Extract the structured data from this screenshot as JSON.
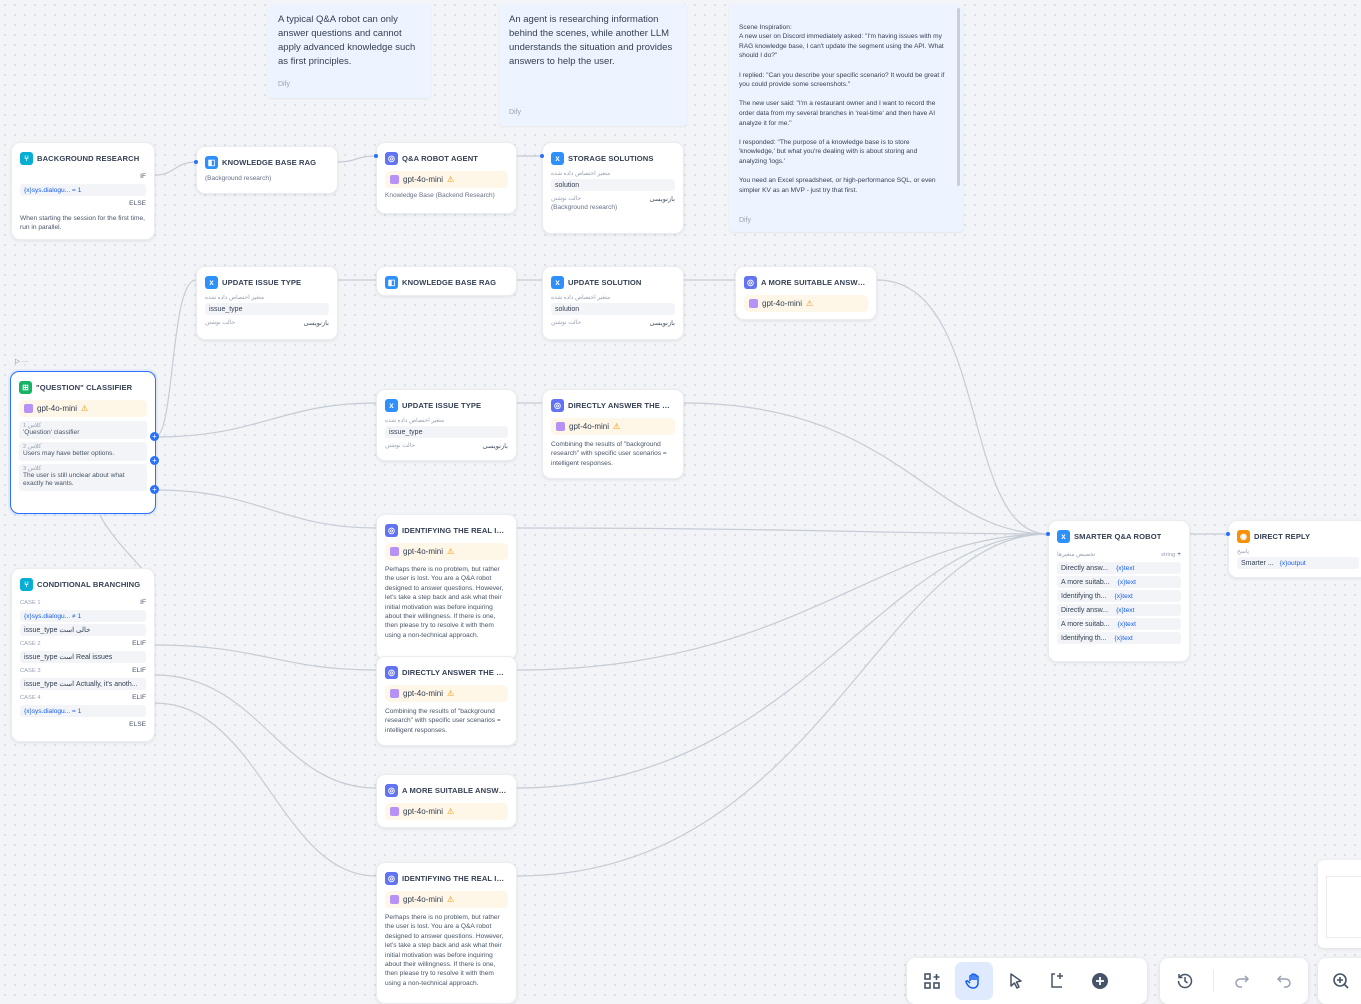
{
  "notes": [
    {
      "text": "A typical Q&A robot can only answer questions and cannot apply advanced knowledge such as first principles.",
      "author": "Dify"
    },
    {
      "text": "An agent is researching information behind the scenes, while another LLM understands the situation and provides answers to help the user.",
      "author": "Dify"
    },
    {
      "text": "Scene Inspiration:\nA new user on Discord immediately asked: \"I'm having issues with my RAG knowledge base, I can't update the segment using the API. What should I do?\"\n\nI replied: \"Can you describe your specific scenario? It would be great if you could provide some screenshots.\"\n\nThe new user said: \"I'm a restaurant owner and I want to record the order data from my several branches in 'real-time' and then have AI analyze it for me.\"\n\nI responded: \"The purpose of a knowledge base is to store 'knowledge,' but what you're dealing with is about storing and analyzing 'logs.'\n\nYou need an Excel spreadsheet, or high-performance SQL, or even simpler KV as an MVP - just try that first.",
      "author": "Dify"
    }
  ],
  "nodes": {
    "background_research": {
      "title": "BACKGROUND RESEARCH",
      "if_label": "IF",
      "condition": "{x}sys.dialogu... = 1",
      "else_label": "ELSE",
      "desc": "When starting the session for the first time, run in parallel."
    },
    "kb_rag_1": {
      "title": "KNOWLEDGE BASE RAG",
      "sub": "(Background research)"
    },
    "qa_robot_agent": {
      "title": "Q&A ROBOT AGENT",
      "model": "gpt-4o-mini",
      "sub": "Knowledge Base (Backend Research)"
    },
    "storage_solutions": {
      "title": "STORAGE SOLUTIONS",
      "assign_label": "متغیر اختصاص داده شده",
      "var": "solution",
      "mode_label": "حالت نوشتن",
      "mode": "بازنویسی",
      "sub": "(Background research)"
    },
    "update_issue_type_1": {
      "title": "UPDATE ISSUE TYPE",
      "assign_label": "متغیر اختصاص داده شده",
      "var": "issue_type",
      "mode_label": "حالت نوشتن",
      "mode": "بازنویسی"
    },
    "kb_rag_2": {
      "title": "KNOWLEDGE BASE RAG"
    },
    "update_solution": {
      "title": "UPDATE SOLUTION",
      "assign_label": "متغیر اختصاص داده شده",
      "var": "solution",
      "mode_label": "حالت نوشتن",
      "mode": "بازنویسی"
    },
    "more_suitable_1": {
      "title": "A MORE SUITABLE ANSWER",
      "model": "gpt-4o-mini"
    },
    "question_classifier": {
      "title": "\"QUESTION\" CLASSIFIER",
      "model": "gpt-4o-mini",
      "classes": [
        {
          "label": "کلاس 1",
          "text": "'Question' classifier"
        },
        {
          "label": "کلاس 2",
          "text": "Users may have better options."
        },
        {
          "label": "کلاس 3",
          "text": "The user is still unclear about what exactly he wants."
        }
      ],
      "toolbar_icons": "▷ ···"
    },
    "update_issue_type_2": {
      "title": "UPDATE ISSUE TYPE",
      "assign_label": "متغیر اختصاص داده شده",
      "var": "issue_type",
      "mode_label": "حالت نوشتن",
      "mode": "بازنویسی"
    },
    "directly_answer_1": {
      "title": "DIRECTLY ANSWER THE QU...",
      "model": "gpt-4o-mini",
      "desc": "Combining the results of \"background research\" with specific user scenarios = intelligent responses."
    },
    "identifying_1": {
      "title": "IDENTIFYING THE REAL ISS...",
      "model": "gpt-4o-mini",
      "desc": "Perhaps there is no problem, but rather the user is lost. You are a Q&A robot designed to answer questions. However, let's take a step back and ask what their initial motivation was before inquiring about their willingness. If there is one, then please try to resolve it with them using a non-technical approach."
    },
    "directly_answer_2": {
      "title": "DIRECTLY ANSWER THE QU...",
      "model": "gpt-4o-mini",
      "desc": "Combining the results of \"background research\" with specific user scenarios = intelligent responses."
    },
    "more_suitable_2": {
      "title": "A MORE SUITABLE ANSWER...",
      "model": "gpt-4o-mini"
    },
    "identifying_2": {
      "title": "IDENTIFYING THE REAL ISS...",
      "model": "gpt-4o-mini",
      "desc": "Perhaps there is no problem, but rather the user is lost. You are a Q&A robot designed to answer questions. However, let's take a step back and ask what their initial motivation was before inquiring about their willingness. If there is one, then please try to resolve it with them using a non-technical approach."
    },
    "conditional_branching": {
      "title": "CONDITIONAL BRANCHING",
      "cases": [
        {
          "case": "CASE 1",
          "tag": "IF",
          "cond": "{x}sys.dialogu... ≠ 1"
        },
        {
          "case": "",
          "tag": "",
          "cond": "issue_type خالی است"
        },
        {
          "case": "CASE 2",
          "tag": "ELIF",
          "cond": "issue_type است Real issues"
        },
        {
          "case": "CASE 3",
          "tag": "ELIF",
          "cond": "issue_type است Actually, it's anoth..."
        },
        {
          "case": "CASE 4",
          "tag": "ELIF",
          "cond": "{x}sys.dialogu... = 1"
        }
      ],
      "else_label": "ELSE"
    },
    "smarter_qa": {
      "title": "SMARTER Q&A ROBOT",
      "header_left": "تخصیص متغیرها",
      "header_right": "string",
      "plus": "+",
      "rows": [
        {
          "name": "Directly answ...",
          "type": "{x}text"
        },
        {
          "name": "A more suitab...",
          "type": "{x}text"
        },
        {
          "name": "Identifying th...",
          "type": "{x}text"
        },
        {
          "name": "Directly answ...",
          "type": "{x}text"
        },
        {
          "name": "A more suitab...",
          "type": "{x}text"
        },
        {
          "name": "Identifying th...",
          "type": "{x}text"
        }
      ]
    },
    "direct_reply": {
      "title": "DIRECT REPLY",
      "label": "پاسخ",
      "var": "Smarter ...",
      "out": "{x}output"
    }
  },
  "toolbar": {
    "add_block": "add-block-icon",
    "hand": "hand-icon",
    "pointer": "pointer-icon",
    "add_note": "add-note-icon",
    "plus": "plus-circle-icon",
    "history": "history-icon",
    "redo": "redo-icon",
    "undo": "undo-icon",
    "zoom": "zoom-in-icon"
  },
  "colors": {
    "accent": "#2970ff",
    "note_bg": "#eef4ff",
    "model_bg": "#fef6e7"
  }
}
